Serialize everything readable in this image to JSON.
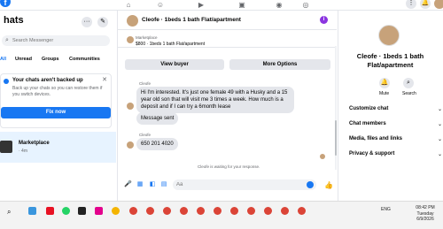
{
  "top_nav": {
    "icons": [
      "home-icon",
      "friends-icon",
      "video-icon",
      "marketplace-icon",
      "groups-icon",
      "gaming-icon"
    ],
    "right_icons": [
      "menu-grid-icon",
      "notifications-icon",
      "profile-icon"
    ]
  },
  "sidebar": {
    "title": "hats",
    "search_placeholder": "Search Messenger",
    "filters": [
      "All",
      "Unread",
      "Groups",
      "Communities"
    ],
    "backup": {
      "title": "Your chats aren't backed up",
      "text": "Back up your chats so you can restore them if you switch devices.",
      "button": "Fix now"
    },
    "chats": [
      {
        "name": "Marketplace",
        "subtitle": "· 4m"
      }
    ]
  },
  "conversation": {
    "title": "Cleofe · 1beds 1 bath Flat/apartment",
    "market_label": "Marketplace",
    "market_value": "$800 · 1beds 1 bath Flat/apartment",
    "view_buyer": "View buyer",
    "more_options": "More Options",
    "messages": [
      {
        "sender": "Cleofe",
        "text": "Hi I'm interested. It's just one female 49 with a Husky and a 15 year old son that will visit me 3 times a week. How much is a deposit and if I can try a 6month lease"
      },
      {
        "sender": "",
        "text": "Message sent"
      },
      {
        "sender": "Cleofe",
        "text": "650 201 4020"
      }
    ],
    "waiting": "Cleofe is waiting for your response.",
    "composer_placeholder": "Aa"
  },
  "details": {
    "title": "Cleofe · 1beds 1 bath Flat/apartment",
    "mute_label": "Mute",
    "search_label": "Search",
    "items": [
      "Customize chat",
      "Chat members",
      "Media, files and links",
      "Privacy & support"
    ]
  },
  "taskbar": {
    "tray_text": "ENG",
    "time": "08:42 PM",
    "day": "Tuesday",
    "date": "6/9/2026"
  }
}
